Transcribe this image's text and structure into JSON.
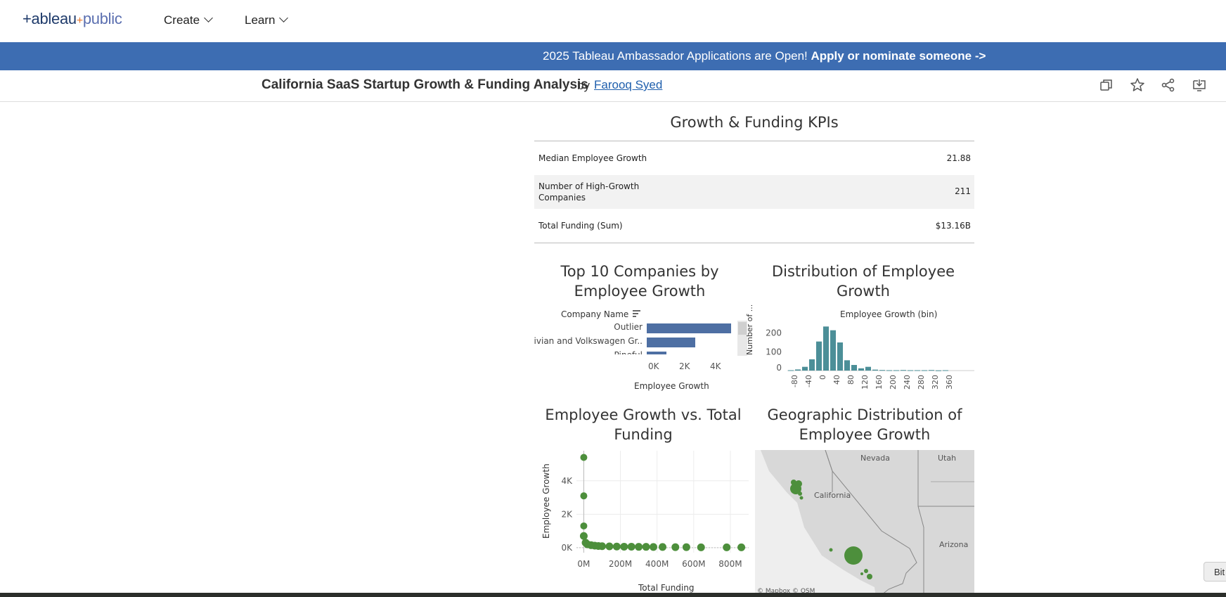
{
  "header": {
    "logo_text_left": "+ableau",
    "logo_cross": "+",
    "logo_text_right": "public",
    "nav": [
      {
        "label": "Create"
      },
      {
        "label": "Learn"
      }
    ]
  },
  "banner": {
    "text": "2025 Tableau Ambassador Applications are Open! ",
    "link": "Apply or nominate someone ->"
  },
  "viz": {
    "title": "California SaaS Startup Growth & Funding Analysis",
    "by": "by",
    "author": "Farooq Syed",
    "toolbar": [
      {
        "icon": "copy-icon"
      },
      {
        "icon": "star-icon"
      },
      {
        "icon": "share-icon"
      },
      {
        "icon": "download-icon"
      }
    ]
  },
  "dashboard": {
    "kpi": {
      "title": "Growth & Funding KPIs",
      "rows": [
        {
          "label": "Median Employee Growth",
          "value": "21.88"
        },
        {
          "label": "Number of High-Growth\nCompanies",
          "value": "211"
        },
        {
          "label": "Total Funding (Sum)",
          "value": "$13.16B"
        }
      ]
    },
    "top10": {
      "title": "Top 10 Companies by Employee Growth",
      "column_header": "Company Name",
      "x_label": "Employee Growth",
      "ticks": [
        "0K",
        "2K",
        "4K"
      ]
    },
    "distribution": {
      "title": "Distribution of Employee Growth",
      "x_label": "Employee Growth (bin)",
      "y_label": "Number of ...",
      "y_ticks": [
        "200",
        "100",
        "0"
      ],
      "x_ticks": [
        "-80",
        "-40",
        "0",
        "40",
        "80",
        "120",
        "160",
        "200",
        "240",
        "280",
        "320",
        "360"
      ]
    },
    "scatter": {
      "title": "Employee Growth vs. Total Funding",
      "x_label": "Total Funding",
      "y_label": "Employee Growth",
      "x_ticks": [
        "0M",
        "200M",
        "400M",
        "600M",
        "800M"
      ],
      "y_ticks": [
        "4K",
        "2K",
        "0K"
      ]
    },
    "map": {
      "title": "Geographic Distribution of Employee Growth",
      "labels": [
        "Nevada",
        "Utah",
        "California",
        "Arizona"
      ],
      "attribution": "© Mapbox  © OSM"
    }
  },
  "chart_data": [
    {
      "type": "bar",
      "title": "Top 10 Companies by Employee Growth",
      "categories": [
        "Outlier",
        "Rivian and Volkswagen Gr..",
        "Pineful"
      ],
      "values": [
        5400,
        3100,
        1250
      ],
      "xlabel": "Employee Growth",
      "ylabel": "Company Name",
      "xlim": [
        0,
        5500
      ]
    },
    {
      "type": "bar",
      "title": "Distribution of Employee Growth",
      "categories": [
        -80,
        -60,
        -40,
        -20,
        0,
        20,
        40,
        60,
        80,
        100,
        120,
        140,
        160,
        180,
        200,
        220,
        240,
        260,
        280,
        300,
        320,
        340,
        360
      ],
      "values": [
        2,
        6,
        20,
        60,
        155,
        235,
        215,
        150,
        55,
        30,
        12,
        20,
        5,
        3,
        2,
        2,
        3,
        2,
        2,
        2,
        3,
        1,
        2
      ],
      "xlabel": "Employee Growth (bin)",
      "ylabel": "Number of ...",
      "ylim": [
        0,
        240
      ]
    },
    {
      "type": "scatter",
      "title": "Employee Growth vs. Total Funding",
      "xlabel": "Total Funding",
      "ylabel": "Employee Growth",
      "x": [
        0,
        0,
        0,
        0,
        10,
        20,
        40,
        60,
        80,
        100,
        140,
        180,
        220,
        260,
        300,
        340,
        380,
        430,
        500,
        560,
        640,
        780,
        860
      ],
      "y": [
        5400,
        3100,
        1300,
        700,
        300,
        200,
        150,
        120,
        100,
        90,
        80,
        70,
        60,
        60,
        50,
        50,
        40,
        40,
        30,
        30,
        20,
        20,
        20
      ],
      "xlim": [
        -40,
        900
      ],
      "ylim": [
        -300,
        5800
      ]
    }
  ]
}
